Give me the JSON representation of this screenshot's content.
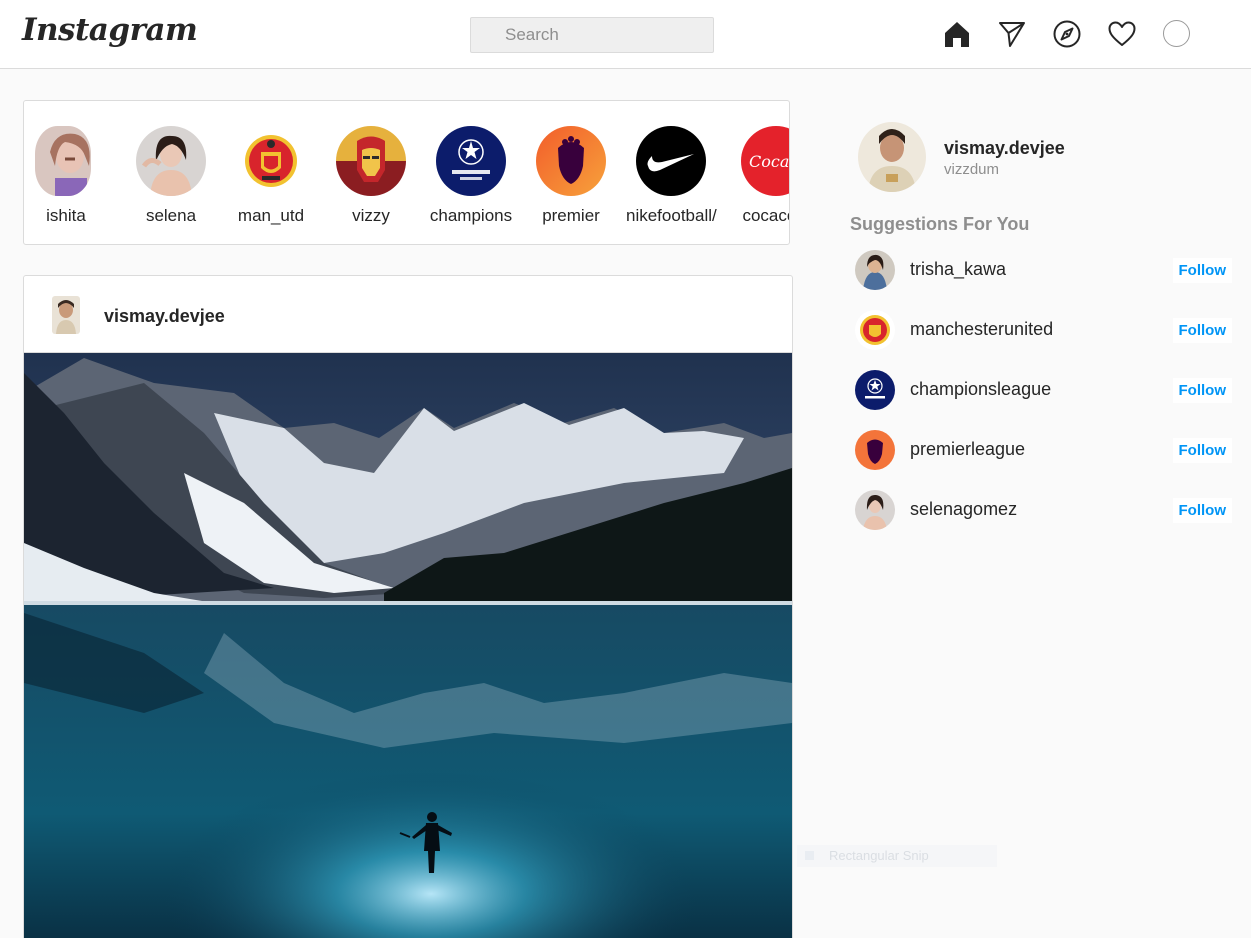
{
  "header": {
    "logo": "Instagram",
    "search_placeholder": "Search",
    "icons": [
      "home-icon",
      "direct-icon",
      "explore-icon",
      "activity-heart-icon",
      "profile-avatar"
    ]
  },
  "stories": [
    {
      "name": "ishita",
      "avatar": "photo"
    },
    {
      "name": "selena",
      "avatar": "photo"
    },
    {
      "name": "man_utd",
      "avatar": "manutd-crest"
    },
    {
      "name": "vizzy",
      "avatar": "ironman"
    },
    {
      "name": "champions",
      "avatar": "ucl-logo"
    },
    {
      "name": "premier",
      "avatar": "pl-lion"
    },
    {
      "name": "nikefootball/",
      "avatar": "nike-swoosh"
    },
    {
      "name": "cocacola",
      "avatar": "cocacola-logo"
    }
  ],
  "post": {
    "username": "vismay.devjee",
    "image": "mountain-lake-night-scene"
  },
  "profile": {
    "username": "vismay.devjee",
    "name": "vizzdum"
  },
  "suggestions": {
    "title": "Suggestions For You",
    "follow_label": "Follow",
    "items": [
      {
        "username": "trisha_kawa"
      },
      {
        "username": "manchesterunited"
      },
      {
        "username": "championsleague"
      },
      {
        "username": "premierleague"
      },
      {
        "username": "selenagomez"
      }
    ]
  },
  "colors": {
    "accent": "#0095f6",
    "border": "#dbdbdb",
    "background": "#fafafa",
    "muted_text": "#8e8e8e"
  },
  "overlay": {
    "snip_hint": "Rectangular Snip"
  }
}
